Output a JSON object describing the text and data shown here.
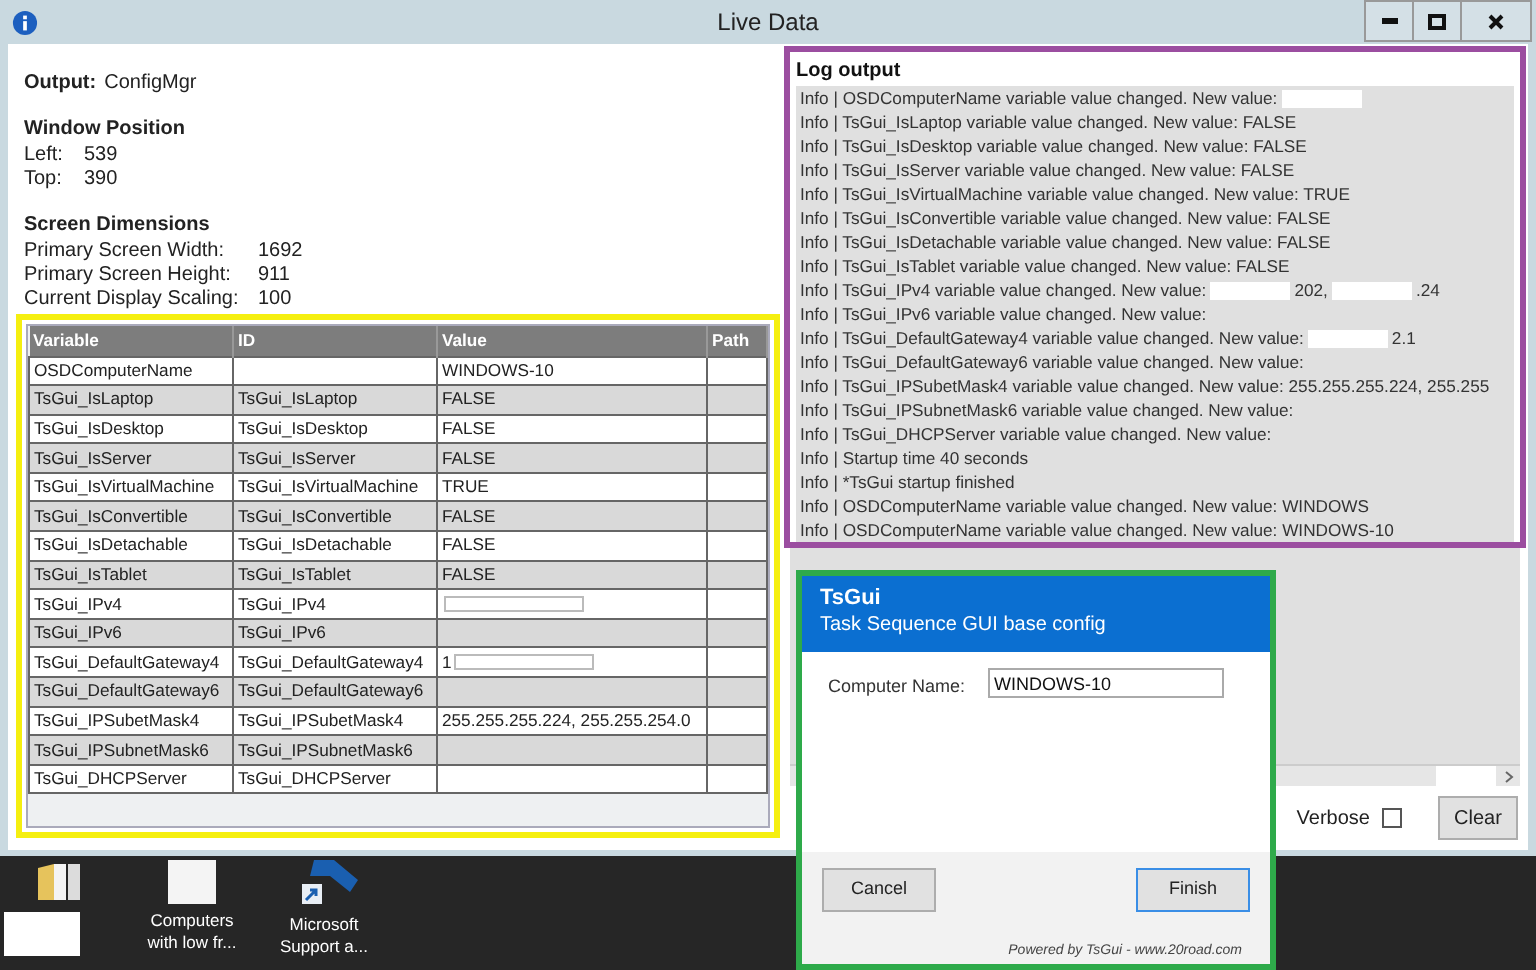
{
  "window": {
    "title": "Live Data"
  },
  "output": {
    "label": "Output:",
    "value": "ConfigMgr"
  },
  "window_position": {
    "heading": "Window Position",
    "rows": [
      {
        "label": "Left:",
        "value": "539"
      },
      {
        "label": "Top:",
        "value": "390"
      }
    ]
  },
  "screen_dimensions": {
    "heading": "Screen Dimensions",
    "rows": [
      {
        "label": "Primary Screen Width:",
        "value": "1692"
      },
      {
        "label": "Primary Screen Height:",
        "value": "911"
      },
      {
        "label": "Current Display Scaling:",
        "value": "100"
      }
    ]
  },
  "table": {
    "columns": [
      "Variable",
      "ID",
      "Value",
      "Path"
    ],
    "rows": [
      {
        "variable": "OSDComputerName",
        "id": "",
        "value": "WINDOWS-10",
        "redacted": false
      },
      {
        "variable": "TsGui_IsLaptop",
        "id": "TsGui_IsLaptop",
        "value": "FALSE",
        "redacted": false
      },
      {
        "variable": "TsGui_IsDesktop",
        "id": "TsGui_IsDesktop",
        "value": "FALSE",
        "redacted": false
      },
      {
        "variable": "TsGui_IsServer",
        "id": "TsGui_IsServer",
        "value": "FALSE",
        "redacted": false
      },
      {
        "variable": "TsGui_IsVirtualMachine",
        "id": "TsGui_IsVirtualMachine",
        "value": "TRUE",
        "redacted": false
      },
      {
        "variable": "TsGui_IsConvertible",
        "id": "TsGui_IsConvertible",
        "value": "FALSE",
        "redacted": false
      },
      {
        "variable": "TsGui_IsDetachable",
        "id": "TsGui_IsDetachable",
        "value": "FALSE",
        "redacted": false
      },
      {
        "variable": "TsGui_IsTablet",
        "id": "TsGui_IsTablet",
        "value": "FALSE",
        "redacted": false
      },
      {
        "variable": "TsGui_IPv4",
        "id": "TsGui_IPv4",
        "value": "",
        "redacted": true
      },
      {
        "variable": "TsGui_IPv6",
        "id": "TsGui_IPv6",
        "value": "",
        "redacted": false
      },
      {
        "variable": "TsGui_DefaultGateway4",
        "id": "TsGui_DefaultGateway4",
        "value": "1",
        "redacted": true
      },
      {
        "variable": "TsGui_DefaultGateway6",
        "id": "TsGui_DefaultGateway6",
        "value": "",
        "redacted": false
      },
      {
        "variable": "TsGui_IPSubetMask4",
        "id": "TsGui_IPSubetMask4",
        "value": "255.255.255.224, 255.255.254.0",
        "redacted": false
      },
      {
        "variable": "TsGui_IPSubnetMask6",
        "id": "TsGui_IPSubnetMask6",
        "value": "",
        "redacted": false
      },
      {
        "variable": "TsGui_DHCPServer",
        "id": "TsGui_DHCPServer",
        "value": "",
        "redacted": false
      }
    ]
  },
  "log": {
    "title": "Log output",
    "lines": [
      {
        "parts": [
          {
            "kind": "text",
            "text": "Info | OSDComputerName variable value changed. New value:"
          },
          {
            "kind": "redacted"
          }
        ]
      },
      {
        "parts": [
          {
            "kind": "text",
            "text": "Info | TsGui_IsLaptop variable value changed. New value: FALSE"
          }
        ]
      },
      {
        "parts": [
          {
            "kind": "text",
            "text": "Info | TsGui_IsDesktop variable value changed. New value: FALSE"
          }
        ]
      },
      {
        "parts": [
          {
            "kind": "text",
            "text": "Info | TsGui_IsServer variable value changed. New value: FALSE"
          }
        ]
      },
      {
        "parts": [
          {
            "kind": "text",
            "text": "Info | TsGui_IsVirtualMachine variable value changed. New value: TRUE"
          }
        ]
      },
      {
        "parts": [
          {
            "kind": "text",
            "text": "Info | TsGui_IsConvertible variable value changed. New value: FALSE"
          }
        ]
      },
      {
        "parts": [
          {
            "kind": "text",
            "text": "Info | TsGui_IsDetachable variable value changed. New value: FALSE"
          }
        ]
      },
      {
        "parts": [
          {
            "kind": "text",
            "text": "Info | TsGui_IsTablet variable value changed. New value: FALSE"
          }
        ]
      },
      {
        "parts": [
          {
            "kind": "text",
            "text": "Info | TsGui_IPv4 variable value changed. New value:"
          },
          {
            "kind": "redacted"
          },
          {
            "kind": "text",
            "text": "202,"
          },
          {
            "kind": "redacted"
          },
          {
            "kind": "text",
            "text": ".24"
          }
        ]
      },
      {
        "parts": [
          {
            "kind": "text",
            "text": "Info | TsGui_IPv6 variable value changed. New value:"
          }
        ]
      },
      {
        "parts": [
          {
            "kind": "text",
            "text": "Info | TsGui_DefaultGateway4 variable value changed. New value:"
          },
          {
            "kind": "redacted"
          },
          {
            "kind": "text",
            "text": "2.1"
          }
        ]
      },
      {
        "parts": [
          {
            "kind": "text",
            "text": "Info | TsGui_DefaultGateway6 variable value changed. New value:"
          }
        ]
      },
      {
        "parts": [
          {
            "kind": "text",
            "text": "Info | TsGui_IPSubetMask4 variable value changed. New value: 255.255.255.224, 255.255"
          }
        ]
      },
      {
        "parts": [
          {
            "kind": "text",
            "text": "Info | TsGui_IPSubnetMask6 variable value changed. New value:"
          }
        ]
      },
      {
        "parts": [
          {
            "kind": "text",
            "text": "Info | TsGui_DHCPServer variable value changed. New value:"
          }
        ]
      },
      {
        "parts": [
          {
            "kind": "text",
            "text": "Info | Startup time 40 seconds"
          }
        ]
      },
      {
        "parts": [
          {
            "kind": "text",
            "text": "Info | *TsGui startup finished"
          }
        ]
      },
      {
        "parts": [
          {
            "kind": "text",
            "text": "Info | OSDComputerName variable value changed. New value: WINDOWS"
          }
        ]
      },
      {
        "parts": [
          {
            "kind": "text",
            "text": "Info | OSDComputerName variable value changed. New value: WINDOWS-10"
          }
        ]
      }
    ]
  },
  "verbose": {
    "label": "Verbose",
    "checked": false
  },
  "clear_button": "Clear",
  "dialog": {
    "title": "TsGui",
    "subtitle": "Task Sequence GUI base config",
    "field": {
      "label": "Computer Name:",
      "value": "WINDOWS-10"
    },
    "buttons": [
      {
        "label": "Cancel",
        "default": false
      },
      {
        "label": "Finish",
        "default": true
      }
    ],
    "footer": "Powered by TsGui - www.20road.com"
  },
  "desktop_icons": [
    {
      "kind": "folder",
      "redacted": true
    },
    {
      "kind": "document",
      "label": "Computers with low fr...",
      "redacted": false
    },
    {
      "kind": "shortcut",
      "label": "Microsoft Support a...",
      "redacted": false
    }
  ]
}
